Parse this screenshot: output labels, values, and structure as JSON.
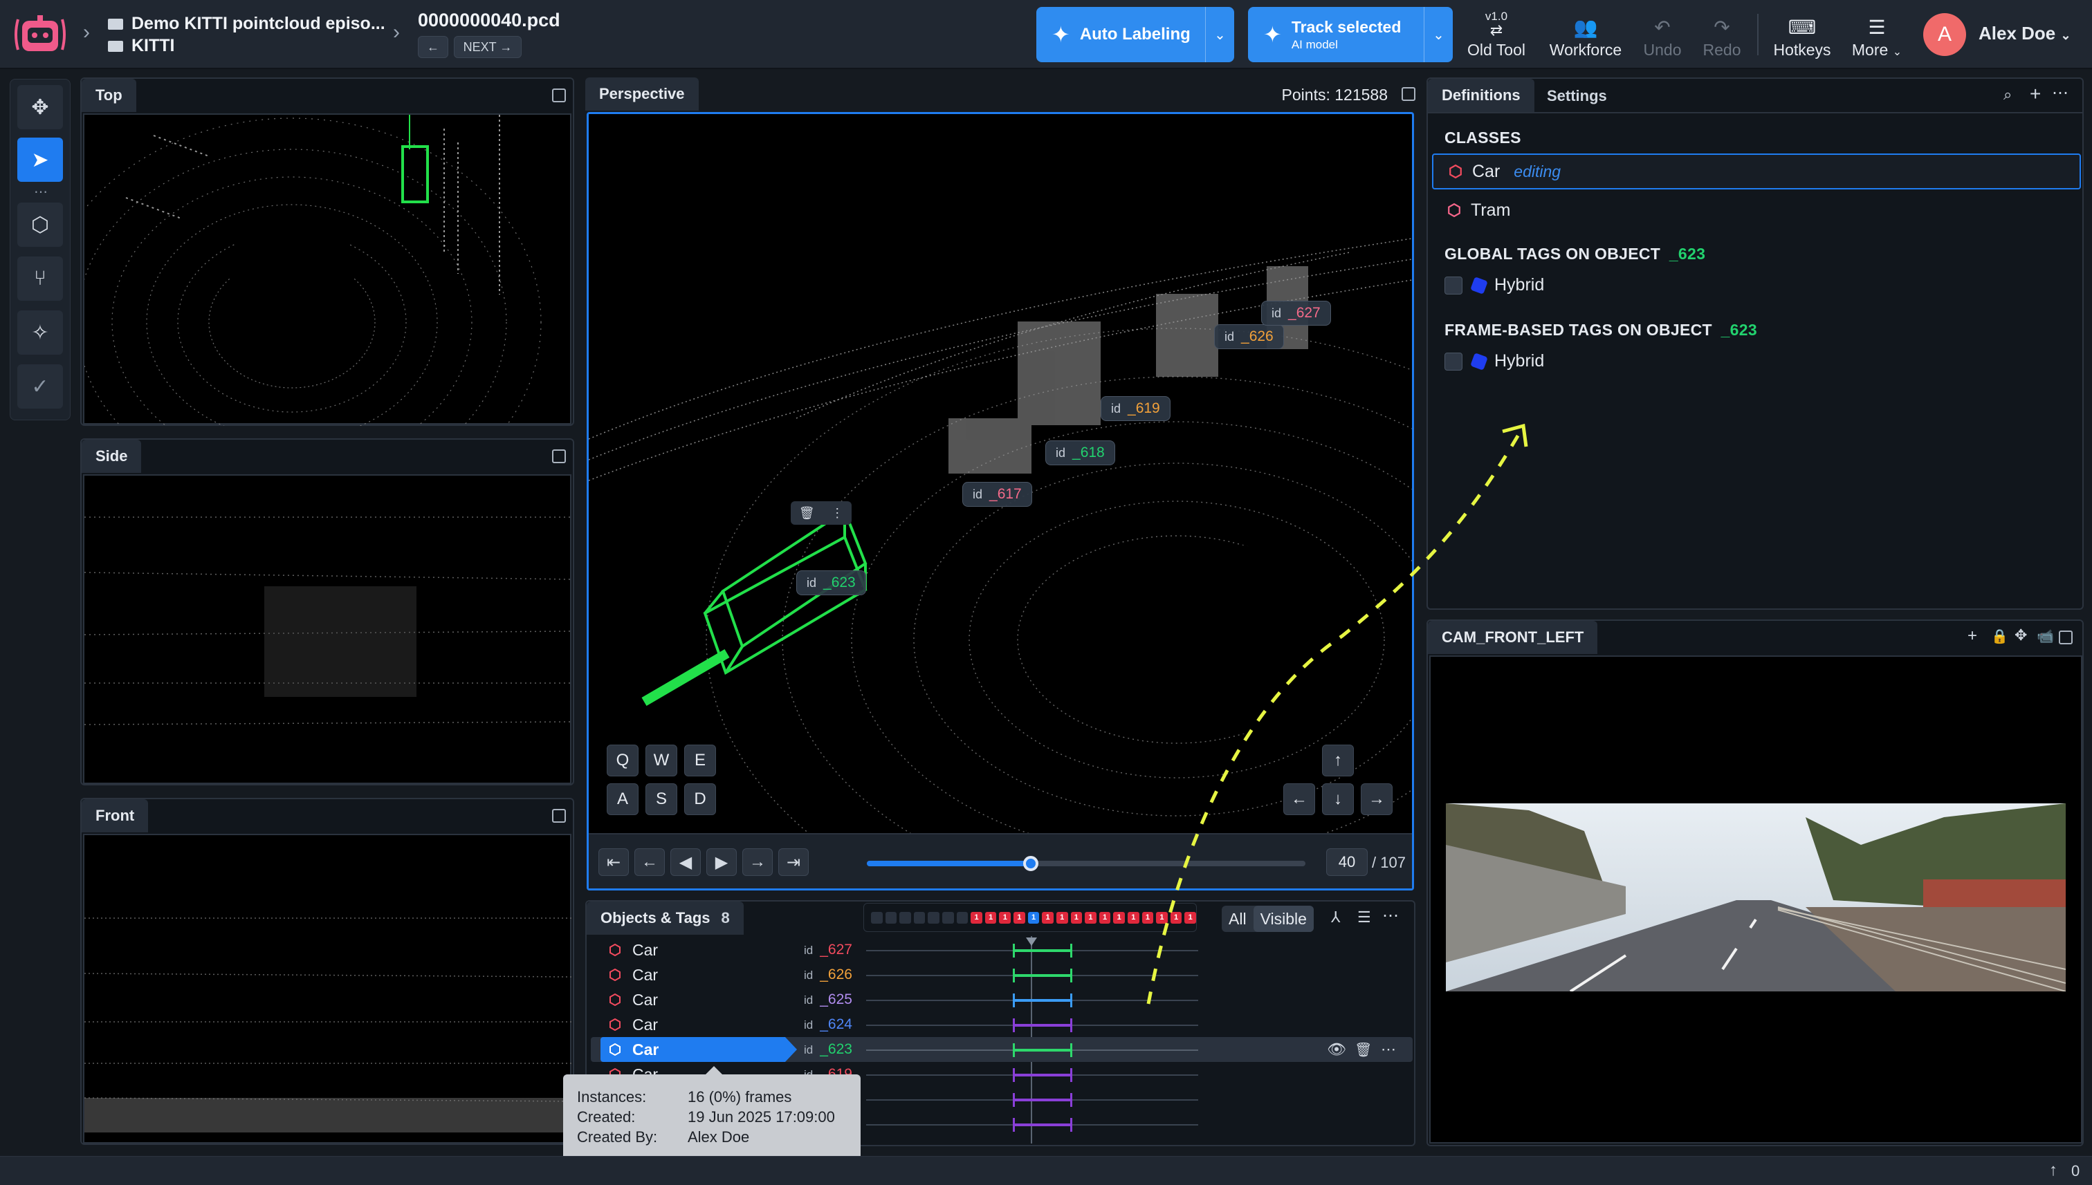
{
  "header": {
    "project_title": "Demo KITTI pointcloud episo...",
    "dataset_name": "KITTI",
    "file_name": "0000000040.pcd",
    "prev_label": "←",
    "next_label": "NEXT →",
    "auto_labeling": "Auto Labeling",
    "track_selected": "Track selected",
    "track_sub": "AI model",
    "old_tool_version": "v1.0",
    "old_tool": "Old Tool",
    "workforce": "Workforce",
    "undo": "Undo",
    "redo": "Redo",
    "hotkeys": "Hotkeys",
    "more": "More",
    "user_initial": "A",
    "user_name": "Alex Doe"
  },
  "views": {
    "top": "Top",
    "side": "Side",
    "front": "Front",
    "perspective": "Perspective",
    "points_label": "Points: 121588"
  },
  "keys": {
    "q": "Q",
    "w": "W",
    "e": "E",
    "a": "A",
    "s": "S",
    "d": "D"
  },
  "arrows": {
    "up": "↑",
    "down": "↓",
    "left": "←",
    "right": "→"
  },
  "playback": {
    "current_frame": "40",
    "total": "/ 107",
    "progress_fraction": 0.374
  },
  "labels3d": {
    "id_prefix": "id",
    "l627": "_627",
    "l626": "_626",
    "l619": "_619",
    "l618": "_618",
    "l617": "_617",
    "l623": "_623"
  },
  "objects_panel": {
    "title": "Objects & Tags",
    "count": "8",
    "filter_all": "All",
    "filter_visible": "Visible",
    "id_prefix": "id",
    "rows": [
      {
        "cls": "Car",
        "id": "_627",
        "color": "#f24b5e"
      },
      {
        "cls": "Car",
        "id": "_626",
        "color": "#f2a13a"
      },
      {
        "cls": "Car",
        "id": "_625",
        "color": "#b28df0"
      },
      {
        "cls": "Car",
        "id": "_624",
        "color": "#4f86f7"
      },
      {
        "cls": "Car",
        "id": "_623",
        "color": "#22d26e"
      },
      {
        "cls": "Car",
        "id": "_619",
        "color": "#f24b5e"
      }
    ]
  },
  "frame_chips": [
    "1",
    "1",
    "1",
    "1",
    "1",
    "1",
    "1",
    "1",
    "1",
    "1",
    "1",
    "1",
    "1",
    "1",
    "1",
    "1"
  ],
  "tooltip": {
    "instances_label": "Instances:",
    "instances_value": "16 (0%) frames",
    "created_label": "Created:",
    "created_value": "19 Jun 2025 17:09:00",
    "created_by_label": "Created By:",
    "created_by_value": "Alex Doe"
  },
  "right_panel": {
    "tab_definitions": "Definitions",
    "tab_settings": "Settings",
    "classes_title": "CLASSES",
    "class_car": "Car",
    "class_car_status": "editing",
    "class_tram": "Tram",
    "global_tags_title": "GLOBAL TAGS ON OBJECT",
    "frame_tags_title": "FRAME-BASED TAGS ON OBJECT",
    "object_id": "_623",
    "tag_hybrid": "Hybrid"
  },
  "camera": {
    "title": "CAM_FRONT_LEFT"
  },
  "statusbar": {
    "count": "0"
  },
  "colors": {
    "accent": "#1f7cf0",
    "box": "#22e04a",
    "arrow": "#e6f542"
  }
}
